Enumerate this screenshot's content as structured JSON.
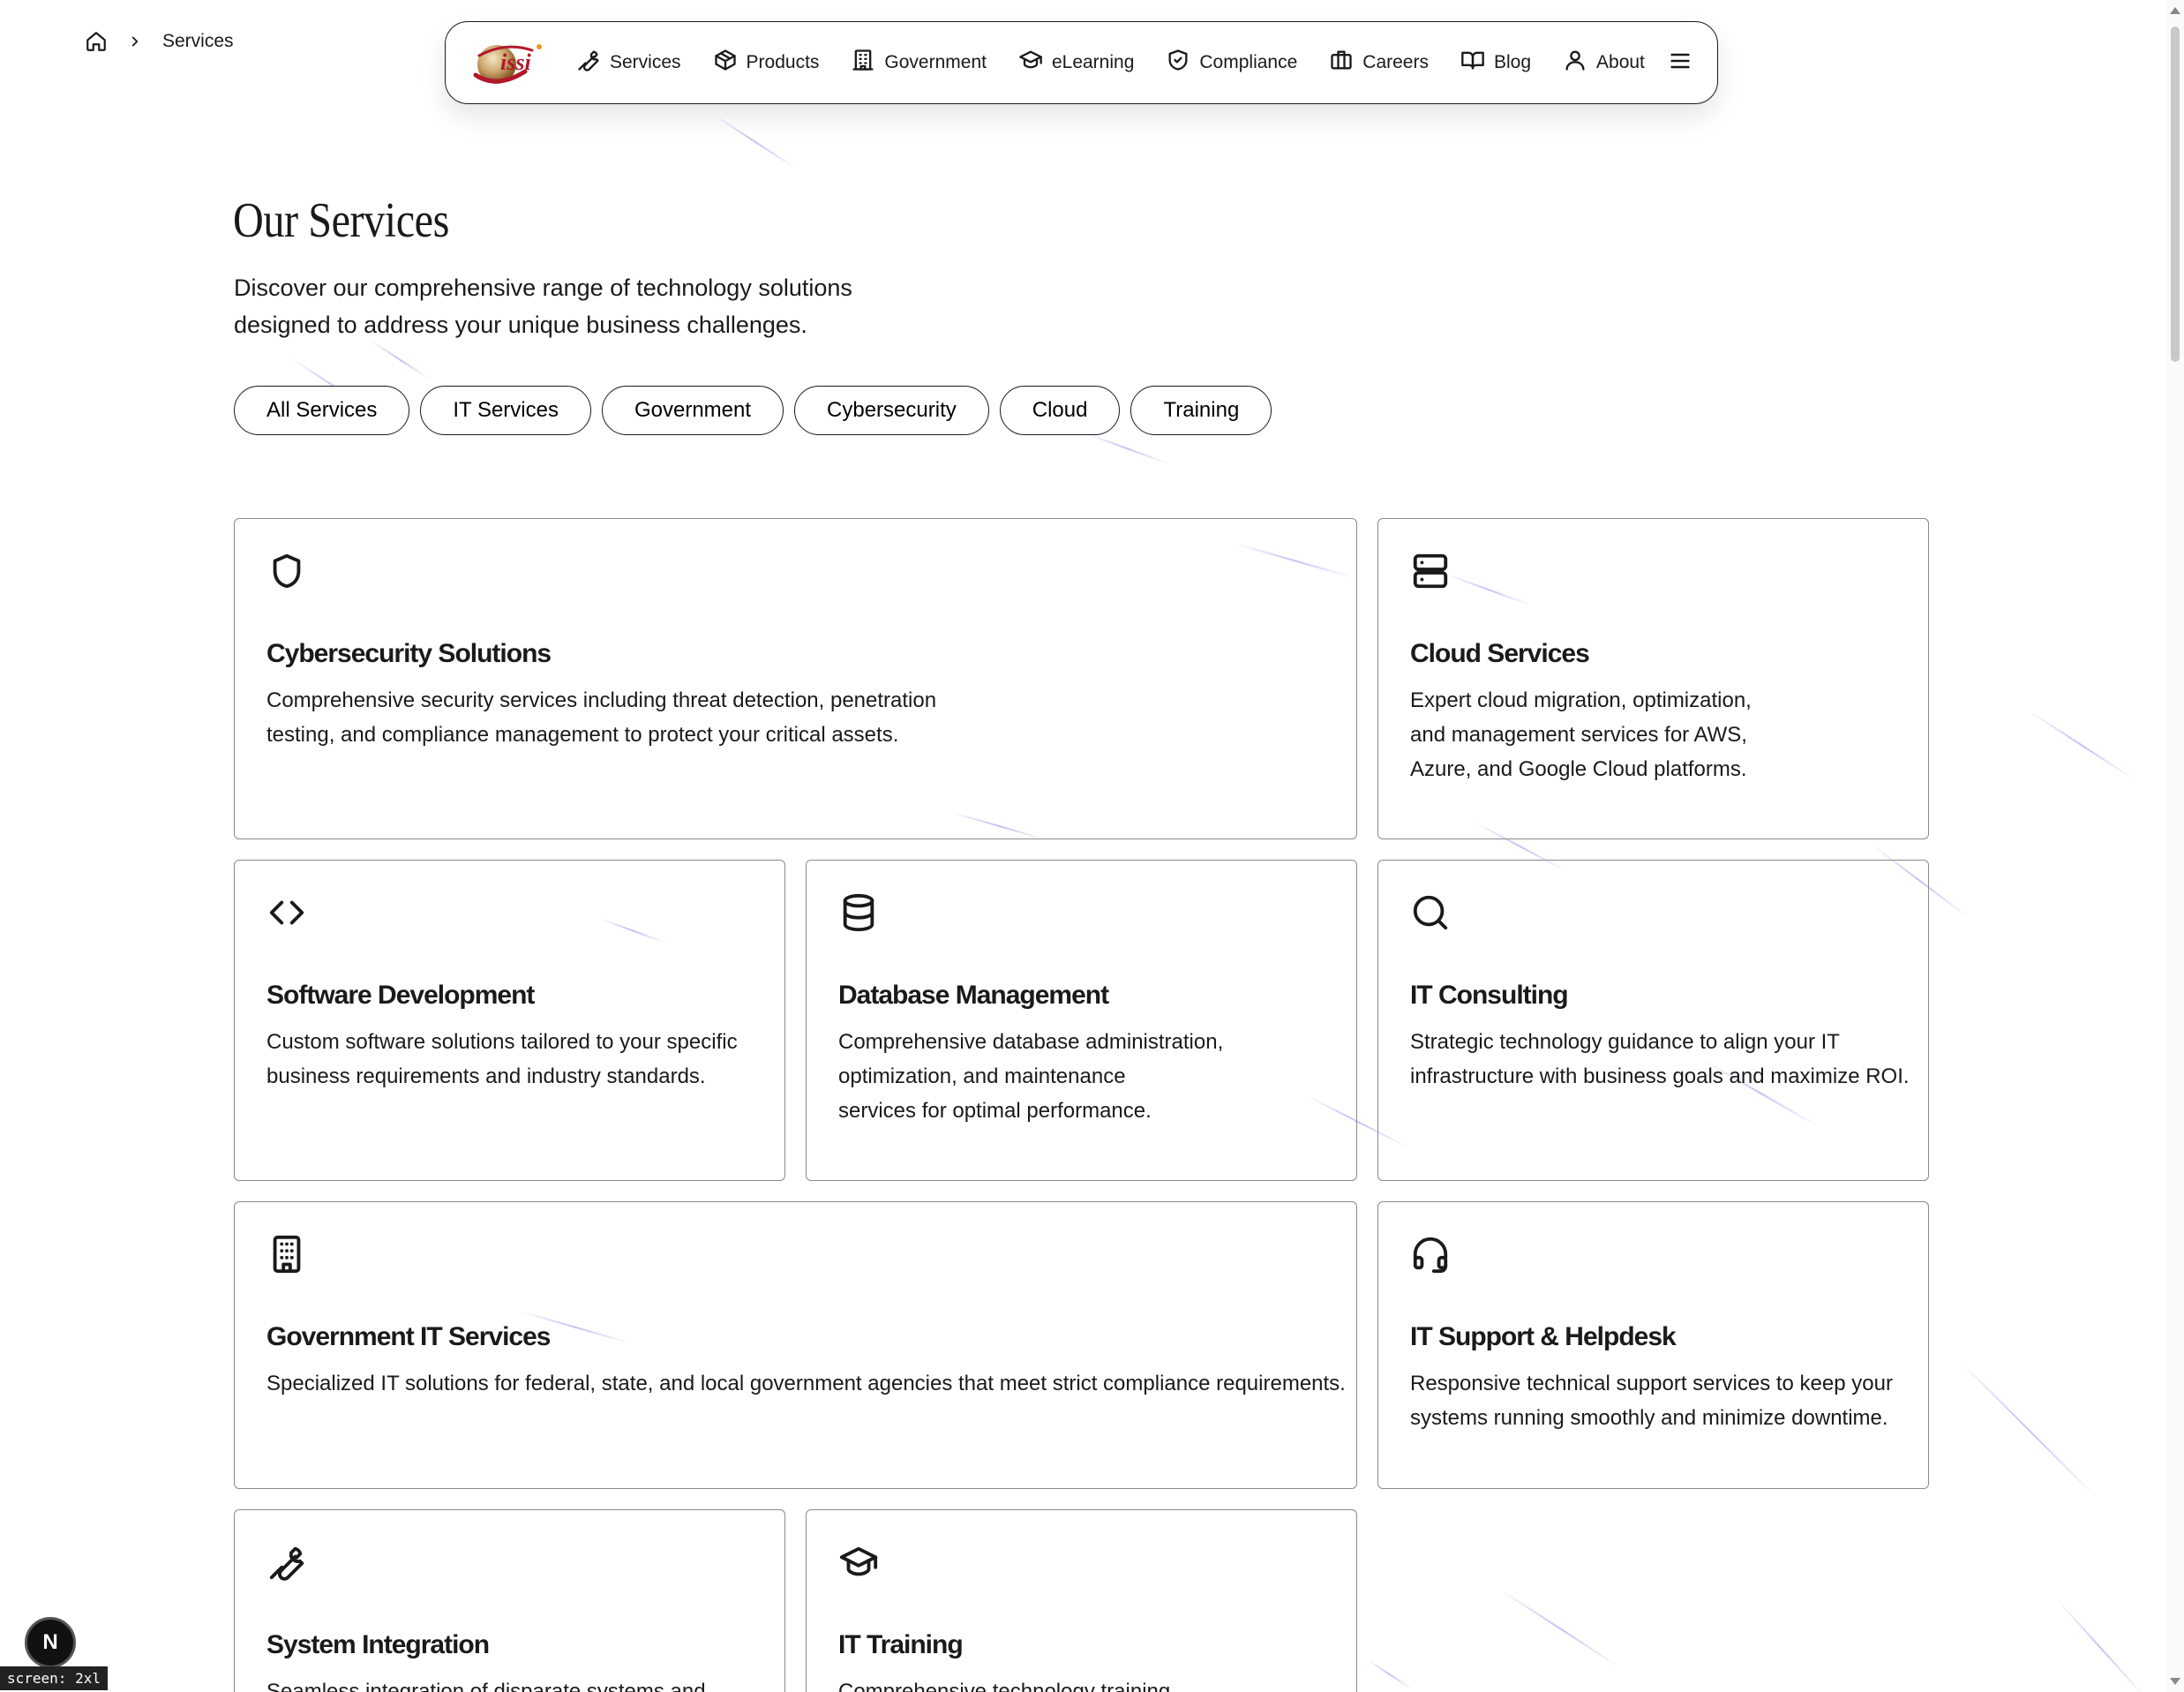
{
  "breadcrumb": {
    "home_icon": "home-icon",
    "separator_icon": "chevron-right-icon",
    "current": "Services"
  },
  "nav": {
    "logo_text": "issi",
    "items": [
      {
        "label": "Services",
        "icon": "wrench-icon"
      },
      {
        "label": "Products",
        "icon": "box-icon"
      },
      {
        "label": "Government",
        "icon": "building-icon"
      },
      {
        "label": "eLearning",
        "icon": "graduation-cap-icon"
      },
      {
        "label": "Compliance",
        "icon": "shield-check-icon"
      },
      {
        "label": "Careers",
        "icon": "briefcase-icon"
      },
      {
        "label": "Blog",
        "icon": "book-open-icon"
      },
      {
        "label": "About",
        "icon": "user-icon"
      }
    ],
    "menu_icon": "hamburger-menu-icon"
  },
  "page": {
    "title": "Our Services",
    "subtitle_line1": "Discover our comprehensive range of technology solutions",
    "subtitle_line2": "designed to address your unique business challenges."
  },
  "filters": [
    "All Services",
    "IT Services",
    "Government",
    "Cybersecurity",
    "Cloud",
    "Training"
  ],
  "cards": [
    {
      "title": "Cybersecurity Solutions",
      "icon": "shield-icon",
      "lines": [
        "Comprehensive security services including threat detection, penetration",
        "testing, and compliance management to protect your critical assets."
      ]
    },
    {
      "title": "Cloud Services",
      "icon": "server-icon",
      "lines": [
        "Expert cloud migration, optimization,",
        "and management services for AWS,",
        "Azure, and Google Cloud platforms."
      ]
    },
    {
      "title": "Software Development",
      "icon": "code-icon",
      "lines": [
        "Custom software solutions tailored to your specific",
        "business requirements and industry standards."
      ]
    },
    {
      "title": "Database Management",
      "icon": "database-icon",
      "lines": [
        "Comprehensive database administration,",
        "optimization, and maintenance",
        "services for optimal performance."
      ]
    },
    {
      "title": "IT Consulting",
      "icon": "search-icon",
      "lines": [
        "Strategic technology guidance to align your IT",
        "infrastructure with business goals and maximize ROI."
      ]
    },
    {
      "title": "Government IT Services",
      "icon": "building-icon",
      "lines": [
        "Specialized IT solutions for federal, state, and local government agencies that meet strict compliance requirements."
      ]
    },
    {
      "title": "IT Support & Helpdesk",
      "icon": "headset-icon",
      "lines": [
        "Responsive technical support services to keep your",
        "systems running smoothly and minimize downtime."
      ]
    },
    {
      "title": "System Integration",
      "icon": "wrench-icon",
      "lines": [
        "Seamless integration of disparate systems and"
      ]
    },
    {
      "title": "IT Training",
      "icon": "graduation-cap-icon",
      "lines": [
        "Comprehensive technology training"
      ]
    }
  ],
  "dev_badge": "N",
  "screen_tag": "screen: 2xl"
}
